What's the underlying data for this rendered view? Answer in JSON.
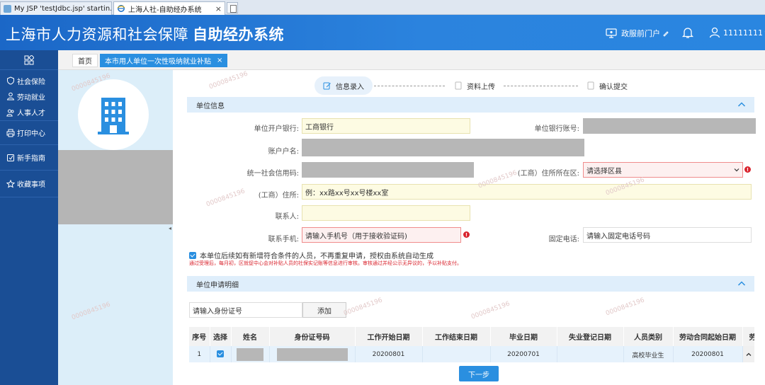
{
  "browser": {
    "tabs": [
      {
        "label": "My JSP 'testJdbc.jsp' startin...",
        "active": false
      },
      {
        "label": "上海人社-自助经办系统",
        "active": true,
        "close": "×"
      }
    ]
  },
  "header": {
    "title_main": "上海市人力资源和社会保障",
    "title_bold": "自助经办系统",
    "portal_link": "政服前门户",
    "user_id": "11111111",
    "icons": [
      "monitor-icon",
      "bell-icon",
      "user-icon"
    ]
  },
  "sidebar": {
    "items": [
      {
        "label": "社会保险",
        "icon": "shield-icon"
      },
      {
        "label": "劳动就业",
        "icon": "person-icon"
      },
      {
        "label": "人事人才",
        "icon": "people-icon"
      },
      {
        "label": "打印中心",
        "icon": "printer-icon"
      },
      {
        "label": "新手指南",
        "icon": "guide-icon"
      },
      {
        "label": "收藏事项",
        "icon": "star-icon"
      }
    ]
  },
  "breadcrumb": {
    "home": "首页",
    "active": "本市用人单位一次性吸纳就业补贴",
    "close": "×"
  },
  "steps": [
    {
      "label": "信息录入",
      "active": true
    },
    {
      "label": "资料上传",
      "active": false
    },
    {
      "label": "确认提交",
      "active": false
    }
  ],
  "unit_info": {
    "section_title": "单位信息",
    "bank_label": "单位开户银行:",
    "bank_value": "工商银行",
    "account_label": "单位银行账号:",
    "account_name_label": "账户户名:",
    "credit_code_label": "统一社会信用码:",
    "district_label": "(工商）住所所在区:",
    "district_value": "请选择区县",
    "address_label": "(工商）住所:",
    "address_placeholder": "例：xx路xx号xx号楼xx室",
    "contact_label": "联系人:",
    "mobile_label": "联系手机:",
    "mobile_placeholder": "请输入手机号（用于接收验证码)",
    "phone_label": "固定电话:",
    "phone_placeholder": "请输入固定电话号码",
    "consent_text": "本单位后续如有新增符合条件的人员，不再重复申请，授权由系统自动生成",
    "notice_text": "通过受理后，每月初，区就促中心会对补贴人员的社保实记账等信息进行审核。审核通过并经公示无异议的，予以补贴支付。"
  },
  "application_detail": {
    "section_title": "单位申请明细",
    "id_placeholder": "请输入身份证号",
    "add_button": "添加",
    "columns": [
      "序号",
      "选择",
      "姓名",
      "身份证号码",
      "工作开始日期",
      "工作结束日期",
      "毕业日期",
      "失业登记日期",
      "人员类别",
      "劳动合同起始日期",
      "劳"
    ],
    "rows": [
      {
        "seq": "1",
        "start": "20200801",
        "end": "",
        "grad": "20200701",
        "unemp": "",
        "category": "高校毕业生",
        "contract": "20200801"
      }
    ]
  },
  "footer": {
    "next_button": "下一步"
  },
  "watermark": "0000845196"
}
